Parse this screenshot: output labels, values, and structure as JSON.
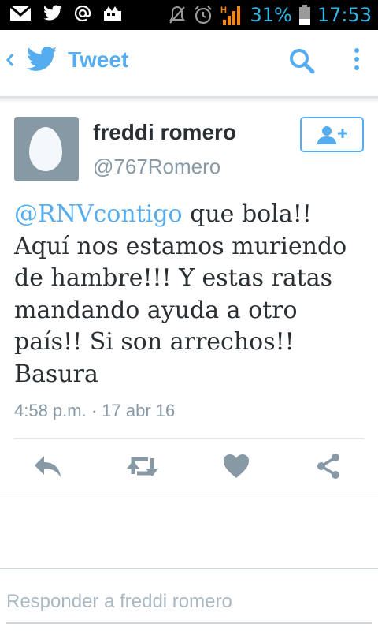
{
  "status_bar": {
    "icons": [
      "gmail-icon",
      "twitter-icon",
      "at-sign-icon",
      "bbm-icon",
      "mute-icon",
      "alarm-icon",
      "signal-h-icon",
      "battery-icon"
    ],
    "battery_percent": "31%",
    "time": "17:53"
  },
  "app_bar": {
    "title": "Tweet",
    "back_icon": "chevron-left-icon",
    "logo_icon": "twitter-bird-icon",
    "search_icon": "search-icon",
    "more_icon": "more-vertical-icon"
  },
  "tweet": {
    "author": {
      "display_name": "freddi romero",
      "handle": "@767Romero",
      "avatar": "default-egg-avatar"
    },
    "follow_icon": "add-user-icon",
    "mention": "@RNVcontigo",
    "text": " que bola!! Aquí nos estamos muriendo de hambre!!! Y estas ratas mandando ayuda a otro país!! Si son arrechos!! Basura",
    "timestamp": "4:58 p.m. · 17 abr 16"
  },
  "actions": [
    {
      "name": "reply",
      "icon": "reply-icon"
    },
    {
      "name": "retweet",
      "icon": "retweet-icon"
    },
    {
      "name": "like",
      "icon": "heart-icon"
    },
    {
      "name": "share",
      "icon": "share-icon"
    }
  ],
  "reply_box": {
    "placeholder": "Responder a freddi romero",
    "value": ""
  },
  "colors": {
    "accent": "#55acee",
    "status_accent": "#33b5e5",
    "text": "#292f33",
    "secondary": "#8899a6",
    "icon_gray": "#8899a6"
  }
}
